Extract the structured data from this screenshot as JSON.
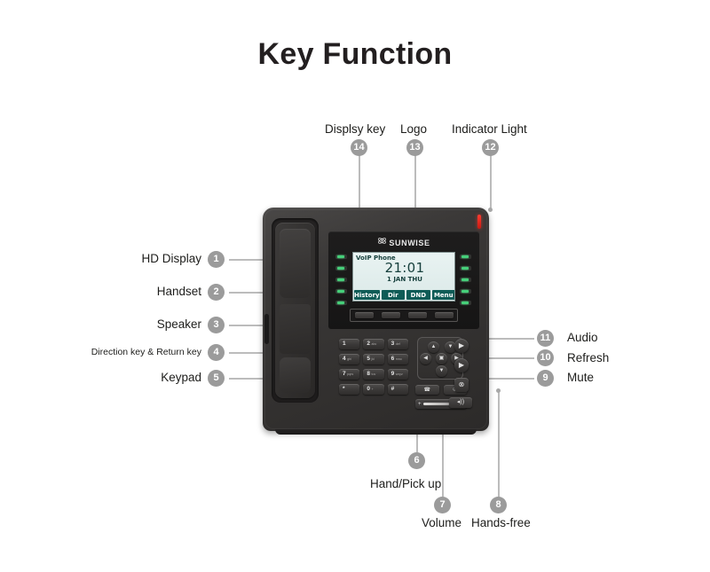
{
  "title": "Key Function",
  "phone": {
    "brand": "SUNWISE",
    "logo_icon": "atom-icon",
    "indicator_light_color": "#ff3b30",
    "lcd": {
      "title": "VoIP Phone",
      "time": "21:01",
      "date": "1 JAN THU",
      "softkeys": [
        "History",
        "Dir",
        "DND",
        "Menu"
      ]
    },
    "line_key_leds": {
      "left_count": 5,
      "right_count": 5,
      "color": "#46d07a"
    },
    "display_keys_count": 4,
    "keypad": [
      {
        "digit": "1",
        "letters": ""
      },
      {
        "digit": "2",
        "letters": "abc"
      },
      {
        "digit": "3",
        "letters": "def"
      },
      {
        "digit": "4",
        "letters": "ghi"
      },
      {
        "digit": "5",
        "letters": "jkl"
      },
      {
        "digit": "6",
        "letters": "mno"
      },
      {
        "digit": "7",
        "letters": "pqrs"
      },
      {
        "digit": "8",
        "letters": "tuv"
      },
      {
        "digit": "9",
        "letters": "wxyz"
      },
      {
        "digit": "*",
        "letters": ""
      },
      {
        "digit": "0",
        "letters": "+"
      },
      {
        "digit": "#",
        "letters": ""
      }
    ],
    "nav": {
      "up": "▲",
      "down": "▼",
      "left": "◀",
      "right": "▶",
      "ok": "▣",
      "secondary": "▼"
    },
    "handset_keys": [
      "☎",
      "✆"
    ],
    "volume": {
      "minus": "−",
      "plus": "+"
    },
    "buttons": {
      "audio": "▶",
      "refresh": "▶",
      "mute": "⊗",
      "handsfree": "◂))"
    }
  },
  "callouts": [
    {
      "number": "1",
      "label": "HD Display"
    },
    {
      "number": "2",
      "label": "Handset"
    },
    {
      "number": "3",
      "label": "Speaker"
    },
    {
      "number": "4",
      "label": "Direction key & Return key"
    },
    {
      "number": "5",
      "label": "Keypad"
    },
    {
      "number": "6",
      "label": "Hand/Pick up"
    },
    {
      "number": "7",
      "label": "Volume"
    },
    {
      "number": "8",
      "label": "Hands-free"
    },
    {
      "number": "9",
      "label": "Mute"
    },
    {
      "number": "10",
      "label": "Refresh"
    },
    {
      "number": "11",
      "label": "Audio"
    },
    {
      "number": "12",
      "label": "Indicator Light"
    },
    {
      "number": "13",
      "label": "Logo"
    },
    {
      "number": "14",
      "label": "Displsy key"
    }
  ]
}
